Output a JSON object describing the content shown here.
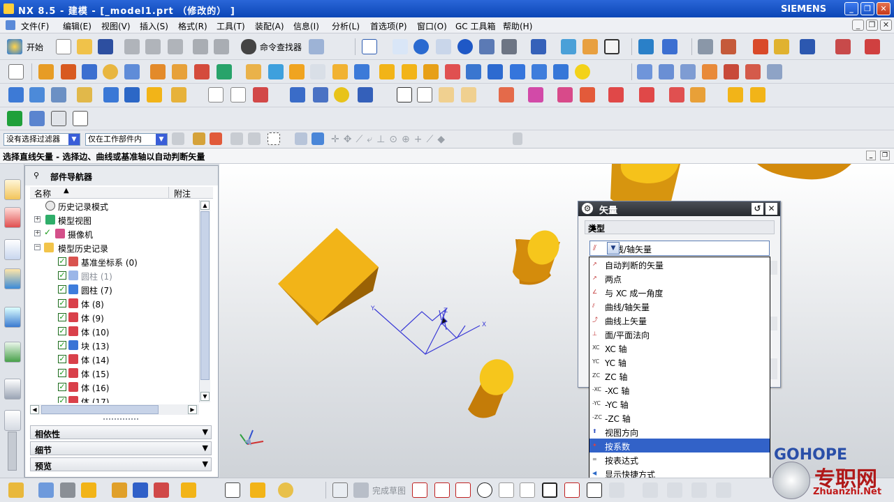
{
  "title": "NX 8.5 - 建模 - [_model1.prt （修改的） ]",
  "brand": "SIEMENS",
  "window_buttons": [
    "_",
    "❐",
    "✕"
  ],
  "menu": [
    "文件(F)",
    "编辑(E)",
    "视图(V)",
    "插入(S)",
    "格式(R)",
    "工具(T)",
    "装配(A)",
    "信息(I)",
    "分析(L)",
    "首选项(P)",
    "窗口(O)",
    "GC 工具箱",
    "帮助(H)"
  ],
  "toolbar": {
    "start_label": "开始",
    "command_finder_label": "命令查找器"
  },
  "filter": {
    "selection_filter": "没有选择过滤器",
    "scope": "仅在工作部件内"
  },
  "cue": "选择直线矢量 - 选择边、曲线或基准轴以自动判断矢量",
  "navigator": {
    "title": "部件导航器",
    "columns": {
      "name": "名称",
      "note": "附注"
    },
    "items": [
      {
        "label": "历史记录模式"
      },
      {
        "label": "模型视图"
      },
      {
        "label": "摄像机"
      },
      {
        "label": "模型历史记录"
      },
      {
        "label": "基准坐标系 (0)"
      },
      {
        "label": "圆柱 (1)"
      },
      {
        "label": "圆柱 (7)"
      },
      {
        "label": "体 (8)"
      },
      {
        "label": "体 (9)"
      },
      {
        "label": "体 (10)"
      },
      {
        "label": "块 (13)"
      },
      {
        "label": "体 (14)"
      },
      {
        "label": "体 (15)"
      },
      {
        "label": "体 (16)"
      },
      {
        "label": "体 (17)"
      }
    ],
    "panels": [
      "相依性",
      "细节",
      "预览"
    ]
  },
  "dialog": {
    "title": "矢量",
    "section": "类型",
    "selected": "曲线/轴矢量",
    "options": [
      "自动判断的矢量",
      "两点",
      "与 XC 成一角度",
      "曲线/轴矢量",
      "曲线上矢量",
      "面/平面法向",
      "XC 轴",
      "YC 轴",
      "ZC 轴",
      "-XC 轴",
      "-YC 轴",
      "-ZC 轴",
      "视图方向",
      "按系数",
      "按表达式",
      "显示快捷方式"
    ],
    "highlighted": "按系数",
    "option_prefixes": [
      "",
      "",
      "",
      "",
      "",
      "",
      "XC",
      "YC",
      "ZC",
      "-XC",
      "-YC",
      "-ZC",
      "",
      "",
      "",
      ""
    ]
  },
  "axis_labels": {
    "x": "X",
    "y": "Y",
    "z": "Z"
  },
  "sketch_label": "完成草图",
  "watermark": {
    "brand": "GOHOPE",
    "cn": "专职网",
    "url": "Zhuanzhi.Net"
  },
  "colors": {
    "title_bar": "#0b46b6",
    "highlight": "#3262c8",
    "solid": "#f2b418",
    "dialog_header": "#2e3238"
  }
}
